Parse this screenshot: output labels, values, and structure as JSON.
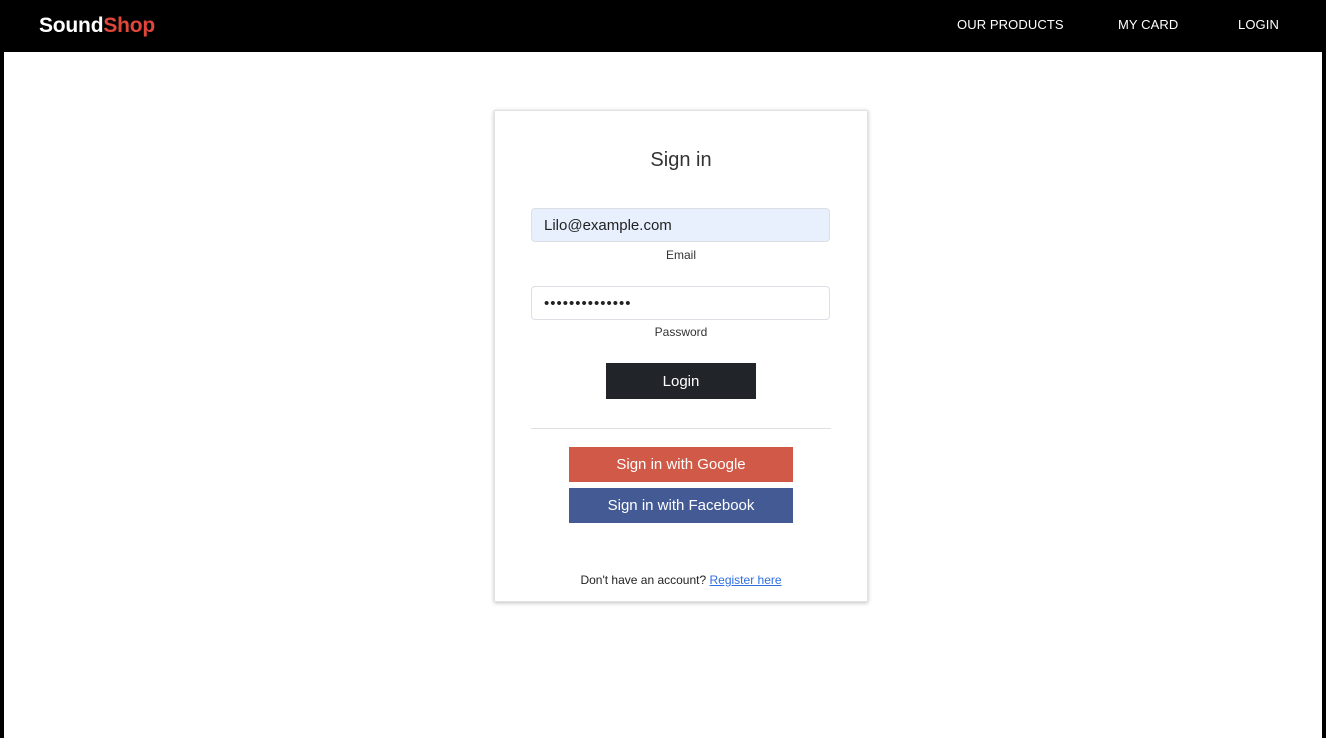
{
  "navbar": {
    "brand_part1": "Sound",
    "brand_part2": "Shop",
    "links": [
      {
        "label": "OUR PRODUCTS"
      },
      {
        "label": "MY CARD"
      },
      {
        "label": "LOGIN"
      }
    ]
  },
  "signin": {
    "title": "Sign in",
    "email": {
      "value": "Lilo@example.com",
      "label": "Email"
    },
    "password": {
      "value": "••••••••••••••",
      "label": "Password"
    },
    "login_button": "Login",
    "google_button": "Sign in with Google",
    "facebook_button": "Sign in with Facebook",
    "register_prompt": "Don't have an account?",
    "register_link": "Register here"
  },
  "colors": {
    "brand_accent": "#e0463a",
    "google": "#d05a47",
    "facebook": "#435a95",
    "login_button": "#212529",
    "email_autofill_bg": "#e8f0fe"
  }
}
